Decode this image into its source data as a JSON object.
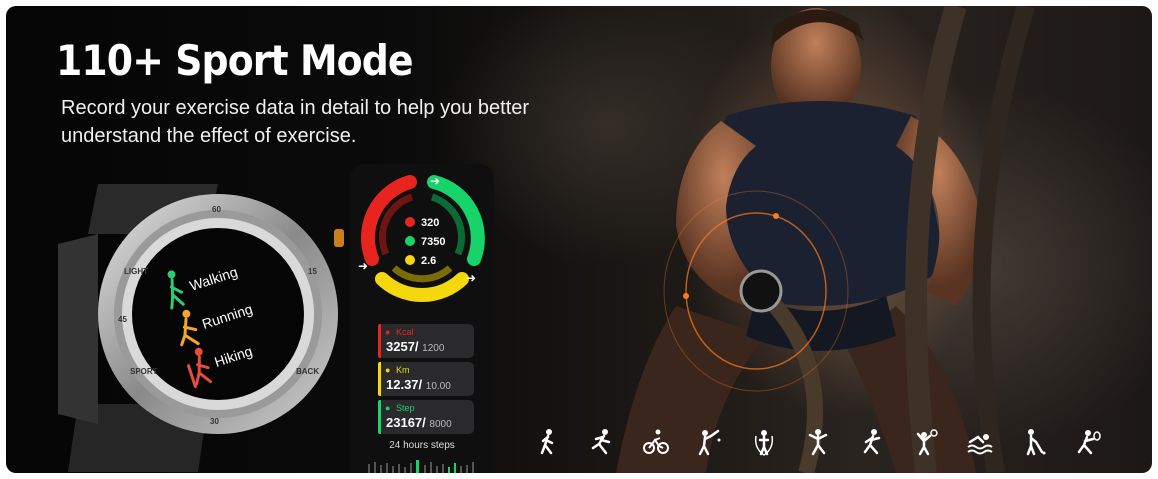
{
  "headline": "110+ Sport Mode",
  "subtitle": "Record your exercise data in detail to help you better understand the effect of exercise.",
  "watch": {
    "bezel": [
      "60",
      "LIGHT",
      "45",
      "SPORT",
      "30",
      "BACK",
      "15"
    ],
    "modes": [
      {
        "label": "Walking",
        "icon": "walking-icon",
        "color": "#2ecc71"
      },
      {
        "label": "Running",
        "icon": "running-icon",
        "color": "#f5a623"
      },
      {
        "label": "Hiking",
        "icon": "hiking-icon",
        "color": "#e74c3c"
      }
    ]
  },
  "rings": {
    "kcal": "320",
    "steps": "7350",
    "km": "2.6",
    "colors": {
      "red": "#e8241f",
      "green": "#17d46a",
      "yellow": "#f4d80c"
    }
  },
  "cards": [
    {
      "label": "Kcal",
      "value": "3257/",
      "goal": "1200",
      "color": "#e8241f",
      "icon": "flame-icon"
    },
    {
      "label": "Km",
      "value": "12.37/",
      "goal": "10.00",
      "color": "#f4d80c",
      "icon": "location-icon"
    },
    {
      "label": "Step",
      "value": "23167/",
      "goal": "8000",
      "color": "#17d46a",
      "icon": "footprint-icon"
    }
  ],
  "steps_caption": "24 hours steps",
  "sport_icons": [
    "walking-icon",
    "running-icon",
    "cycling-icon",
    "badminton-icon",
    "jump-rope-icon",
    "dancing-icon",
    "climbing-icon",
    "volleyball-icon",
    "swimming-icon",
    "golf-icon",
    "tennis-icon"
  ]
}
